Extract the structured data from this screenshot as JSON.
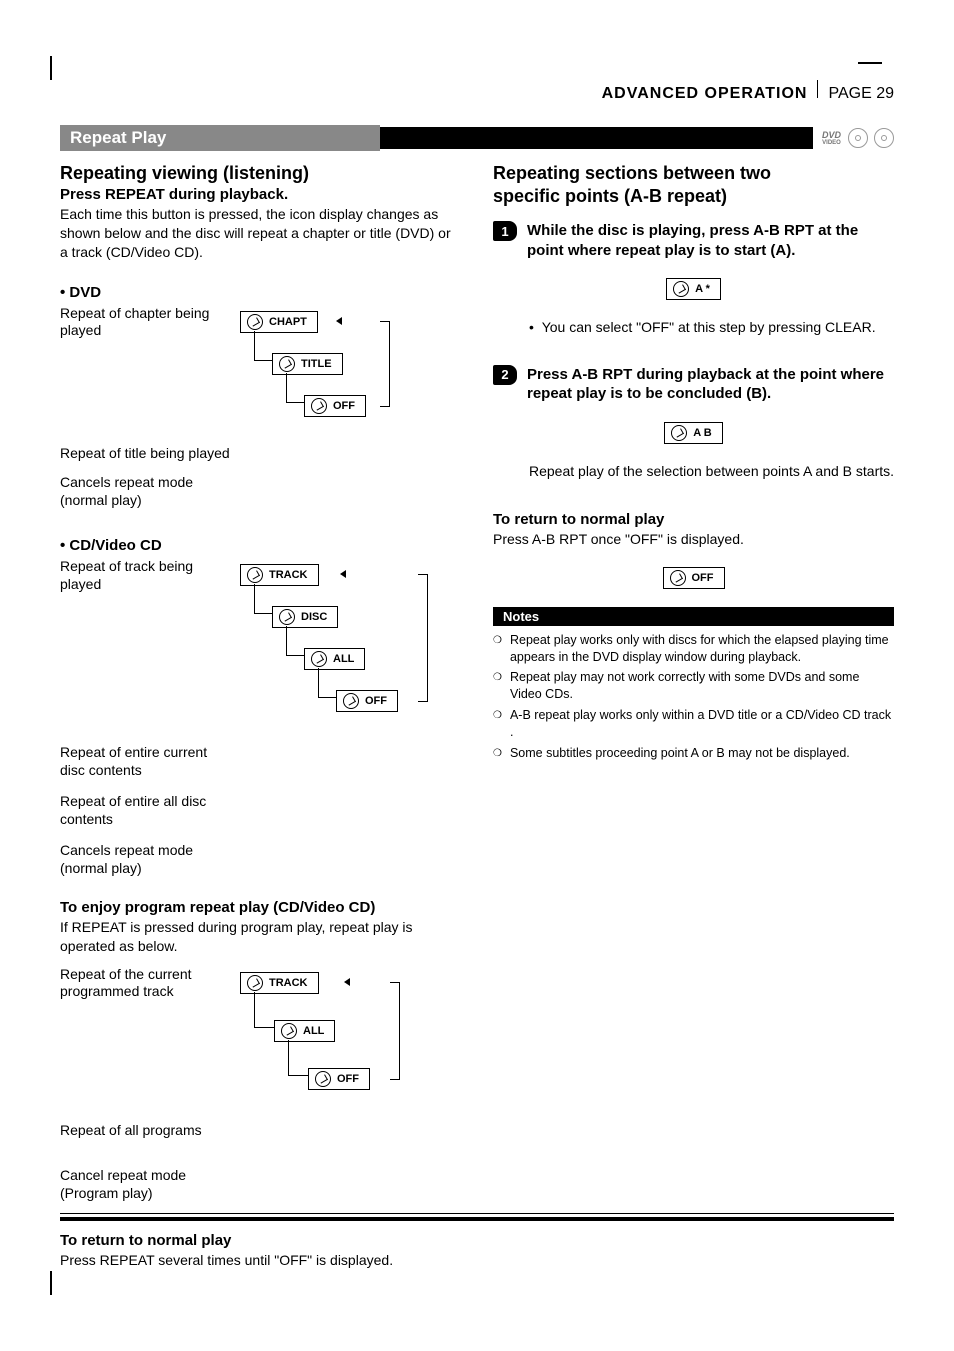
{
  "header": {
    "section": "ADVANCED OPERATION",
    "page": "PAGE 29"
  },
  "sectionBar": "Repeat Play",
  "logos": {
    "dvd": "DVD",
    "dvdSub": "VIDEO",
    "disc1": "disc",
    "disc2": "disc"
  },
  "left": {
    "h1": "Repeating viewing (listening)",
    "sub": "Press REPEAT during playback.",
    "para": "Each time this button is pressed, the icon display changes as shown below and the disc will repeat a chapter or title (DVD) or a track (CD/Video CD).",
    "dvdHead": "• DVD",
    "dvd": {
      "r1": "Repeat of chapter being played",
      "c1": "CHAPT",
      "r2": "Repeat of title being played",
      "c2": "TITLE",
      "r3": "Cancels repeat mode (normal play)",
      "c3": "OFF"
    },
    "cdHead": "• CD/Video CD",
    "cd": {
      "r1": "Repeat of track being played",
      "c1": "TRACK",
      "r2": "Repeat of entire current disc contents",
      "c2": "DISC",
      "r3": "Repeat of entire all disc contents",
      "c3": "ALL",
      "r4": "Cancels repeat mode (normal play)",
      "c4": "OFF"
    },
    "progHead": "To enjoy program repeat play (CD/Video CD)",
    "progPara": "If REPEAT is pressed during program play, repeat play is operated as below.",
    "prog": {
      "r1": "Repeat of the current programmed track",
      "c1": "TRACK",
      "r2": "Repeat of all programs",
      "c2": "ALL",
      "r3": "Cancel repeat mode (Program play)",
      "c3": "OFF"
    },
    "retHead": "To return to normal play",
    "retPara": "Press REPEAT several times until \"OFF\" is displayed."
  },
  "right": {
    "h1a": "Repeating sections between two",
    "h1b": "specific points (A-B repeat)",
    "step1": {
      "n": "1",
      "txt": "While the disc is playing, press A-B RPT at the point where repeat play is to start (A).",
      "chip": "A    *"
    },
    "bullet1": "You can select \"OFF\" at this step by pressing CLEAR.",
    "step2": {
      "n": "2",
      "txt": "Press A-B RPT during playback at the point where repeat play is to be concluded (B).",
      "chip": "A   B"
    },
    "afterStep2": "Repeat play of the selection between points A and B starts.",
    "retHead": "To return to normal play",
    "retPara": "Press A-B RPT once \"OFF\" is displayed.",
    "offChip": "OFF",
    "notesHead": "Notes",
    "notes": [
      "Repeat play works only with discs for which the elapsed playing time appears in the DVD display window during playback.",
      "Repeat play may not work correctly with some DVDs and some Video CDs.",
      "A-B repeat play works only within a DVD title or a CD/Video CD track .",
      "Some subtitles proceeding point A or B may not be displayed."
    ]
  }
}
